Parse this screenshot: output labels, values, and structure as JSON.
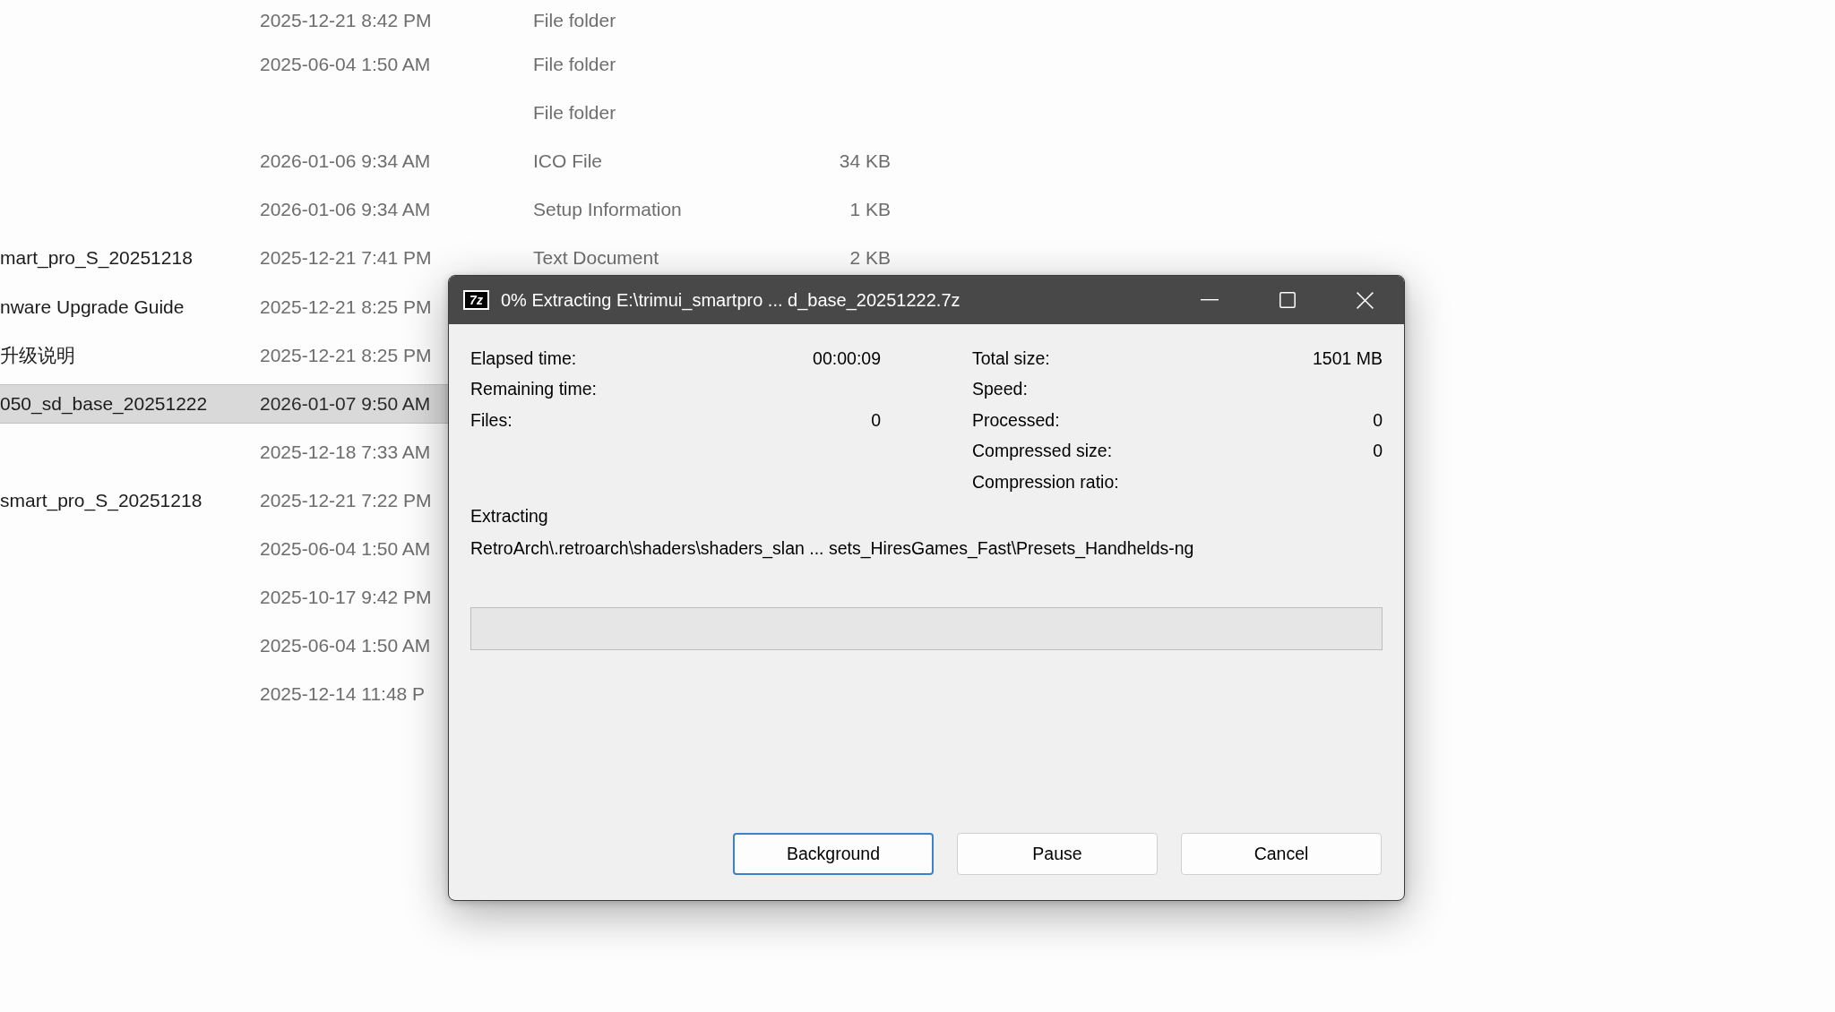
{
  "file_list": {
    "rows": [
      {
        "date": "2025-12-21 8:42 PM",
        "type": "File folder",
        "selected": false
      },
      {
        "date": "2025-06-04 1:50 AM",
        "type": "File folder",
        "selected": false
      },
      {
        "type": "File folder",
        "selected": false
      },
      {
        "date": "2026-01-06 9:34 AM",
        "type": "ICO File",
        "size": "34 KB",
        "selected": false
      },
      {
        "date": "2026-01-06 9:34 AM",
        "type": "Setup Information",
        "size": "1 KB",
        "selected": false
      },
      {
        "name": "mart_pro_S_20251218",
        "date": "2025-12-21 7:41 PM",
        "type": "Text Document",
        "size": "2 KB",
        "selected": false
      },
      {
        "name": "nware Upgrade Guide",
        "date": "2025-12-21 8:25 PM",
        "selected": false
      },
      {
        "name": "升级说明",
        "date": "2025-12-21 8:25 PM",
        "selected": false
      },
      {
        "name": "050_sd_base_20251222",
        "date": "2026-01-07 9:50 AM",
        "selected": true
      },
      {
        "date": "2025-12-18 7:33 AM",
        "selected": false
      },
      {
        "name": "smart_pro_S_20251218",
        "date": "2025-12-21 7:22 PM",
        "selected": false
      },
      {
        "date": "2025-06-04 1:50 AM",
        "selected": false
      },
      {
        "date": "2025-10-17 9:42 PM",
        "selected": false
      },
      {
        "date": "2025-06-04 1:50 AM",
        "selected": false
      },
      {
        "date": "2025-12-14 11:48 P",
        "selected": false
      }
    ]
  },
  "dialog": {
    "app_logo": "7z",
    "title": "0% Extracting E:\\trimui_smartpro ... d_base_20251222.7z",
    "stats_left": [
      {
        "label": "Elapsed time:",
        "value": "00:00:09"
      },
      {
        "label": "Remaining time:"
      },
      {
        "label": "Files:",
        "value": "0"
      }
    ],
    "stats_right": [
      {
        "label": "Total size:",
        "value": "1501 MB"
      },
      {
        "label": "Speed:"
      },
      {
        "label": "Processed:",
        "value": "0"
      },
      {
        "label": "Compressed size:",
        "value": "0"
      },
      {
        "label": "Compression ratio:"
      }
    ],
    "status": "Extracting",
    "current_file": "RetroArch\\.retroarch\\shaders\\shaders_slan ... sets_HiresGames_Fast\\Presets_Handhelds-ng",
    "progress": {
      "level": 0
    },
    "buttons": [
      {
        "label": "Background",
        "focused": true
      },
      {
        "label": "Pause",
        "focused": false
      },
      {
        "label": "Cancel",
        "focused": false
      }
    ]
  }
}
